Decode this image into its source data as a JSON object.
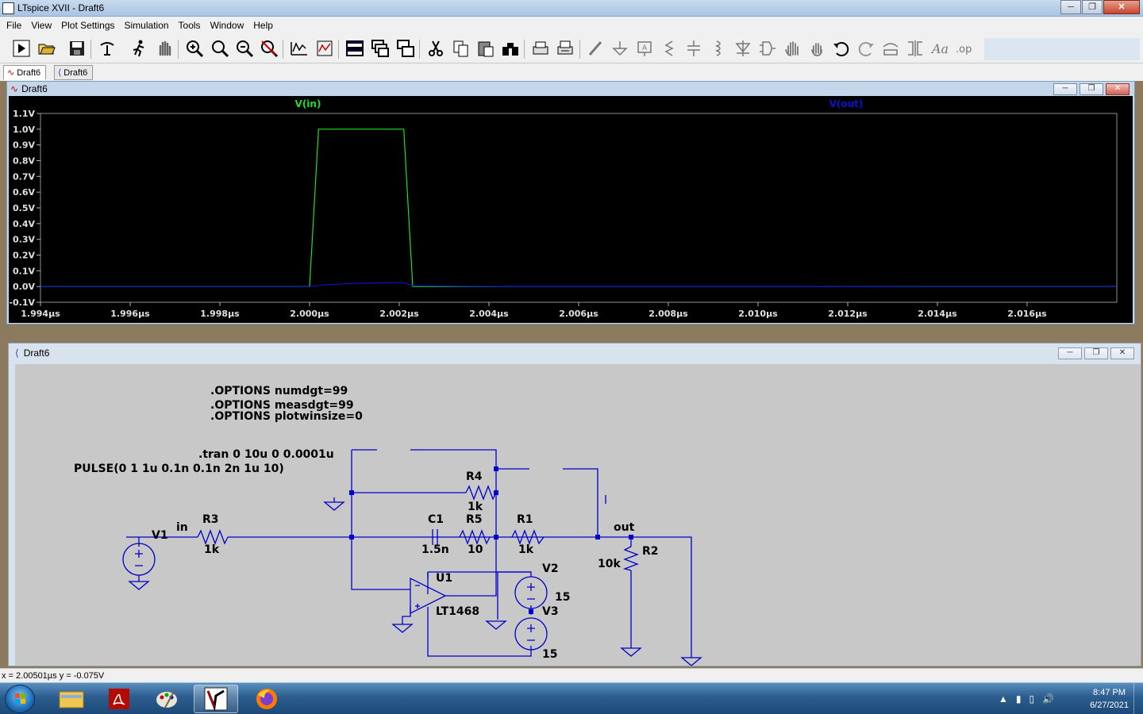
{
  "window": {
    "title": "LTspice XVII - Draft6",
    "controls": [
      "minimize",
      "maximize",
      "close"
    ]
  },
  "menu": [
    "File",
    "View",
    "Plot Settings",
    "Simulation",
    "Tools",
    "Window",
    "Help"
  ],
  "toolbar": {
    "icons": [
      "run-icon",
      "open-icon",
      "save-icon",
      "control-panel-icon",
      "run-man-icon",
      "halt-hand-icon",
      "zoom-in-icon",
      "zoom-full-icon",
      "zoom-out-icon",
      "zoom-cancel-icon",
      "autorange-icon",
      "zoom-area-icon",
      "tile-horizontal-icon",
      "cascade-icon",
      "tile-vertical-icon",
      "cut-icon",
      "copy-icon",
      "paste-icon",
      "find-icon",
      "print-icon",
      "print-setup-icon",
      "wire-icon",
      "ground-icon",
      "label-icon",
      "resistor-icon",
      "capacitor-icon",
      "inductor-icon",
      "diode-icon",
      "component-icon",
      "move-icon",
      "drag-icon",
      "undo-icon",
      "redo-icon",
      "rotate-icon",
      "mirror-icon",
      "text-icon",
      "spice-directive-icon"
    ]
  },
  "tabs": [
    {
      "label": "Draft6",
      "kind": "waveform",
      "active": true
    },
    {
      "label": "Draft6",
      "kind": "schematic",
      "active": false
    }
  ],
  "plot_window": {
    "title": "Draft6"
  },
  "chart_data": {
    "type": "line",
    "title": "",
    "xlabel": "",
    "ylabel": "",
    "xlim": [
      1.994,
      2.018
    ],
    "ylim": [
      -0.1,
      1.1
    ],
    "x_ticks": [
      "1.994µs",
      "1.996µs",
      "1.998µs",
      "2.000µs",
      "2.002µs",
      "2.004µs",
      "2.006µs",
      "2.008µs",
      "2.010µs",
      "2.012µs",
      "2.014µs",
      "2.016µs"
    ],
    "y_ticks": [
      "1.1V",
      "1.0V",
      "0.9V",
      "0.8V",
      "0.7V",
      "0.6V",
      "0.5V",
      "0.4V",
      "0.3V",
      "0.2V",
      "0.1V",
      "0.0V",
      "-0.1V"
    ],
    "series": [
      {
        "name": "V(in)",
        "color": "#20e020",
        "x": [
          1.994,
          2.0,
          2.0001,
          2.0002,
          2.0021,
          2.0022,
          2.0023,
          2.018
        ],
        "y": [
          0.0,
          0.0,
          0.5,
          1.0,
          1.0,
          0.5,
          0.0,
          0.0
        ]
      },
      {
        "name": "V(out)",
        "color": "#1010d0",
        "x": [
          1.994,
          2.0,
          2.0003,
          2.001,
          2.0021,
          2.0023,
          2.0035,
          2.0048,
          2.018
        ],
        "y": [
          0.0,
          0.0,
          0.01,
          0.02,
          0.025,
          0.005,
          0.002,
          0.0005,
          0.0
        ]
      }
    ],
    "grid": false,
    "legend": "top"
  },
  "schematic_window": {
    "title": "Draft6"
  },
  "schematic": {
    "directives": [
      ".OPTIONS numdgt=99",
      ".OPTIONS measdgt=99",
      ".OPTIONS plotwinsize=0"
    ],
    "tran": ".tran 0 10u 0 0.0001u",
    "pulse": "PULSE(0 1 1u 0.1n 0.1n 2n 1u 10)",
    "labels": {
      "v1": "V1",
      "in": "in",
      "r3": "R3",
      "r3v": "1k",
      "r4": "R4",
      "r4v": "1k",
      "c1": "C1",
      "c1v": "1.5n",
      "r5": "R5",
      "r5v": "10",
      "r1": "R1",
      "r1v": "1k",
      "out": "out",
      "r2": "R2",
      "r2v": "10k",
      "u1": "U1",
      "u1part": "LT1468",
      "v2": "V2",
      "v2v": "15",
      "v3": "V3",
      "v3v": "15"
    }
  },
  "status": {
    "text": "x = 2.00501µs    y = -0.075V"
  },
  "taskbar": {
    "apps": [
      "explorer",
      "acrobat",
      "paint",
      "ltspice",
      "firefox"
    ],
    "active_app": "ltspice",
    "time": "8:47 PM",
    "date": "6/27/2021"
  }
}
